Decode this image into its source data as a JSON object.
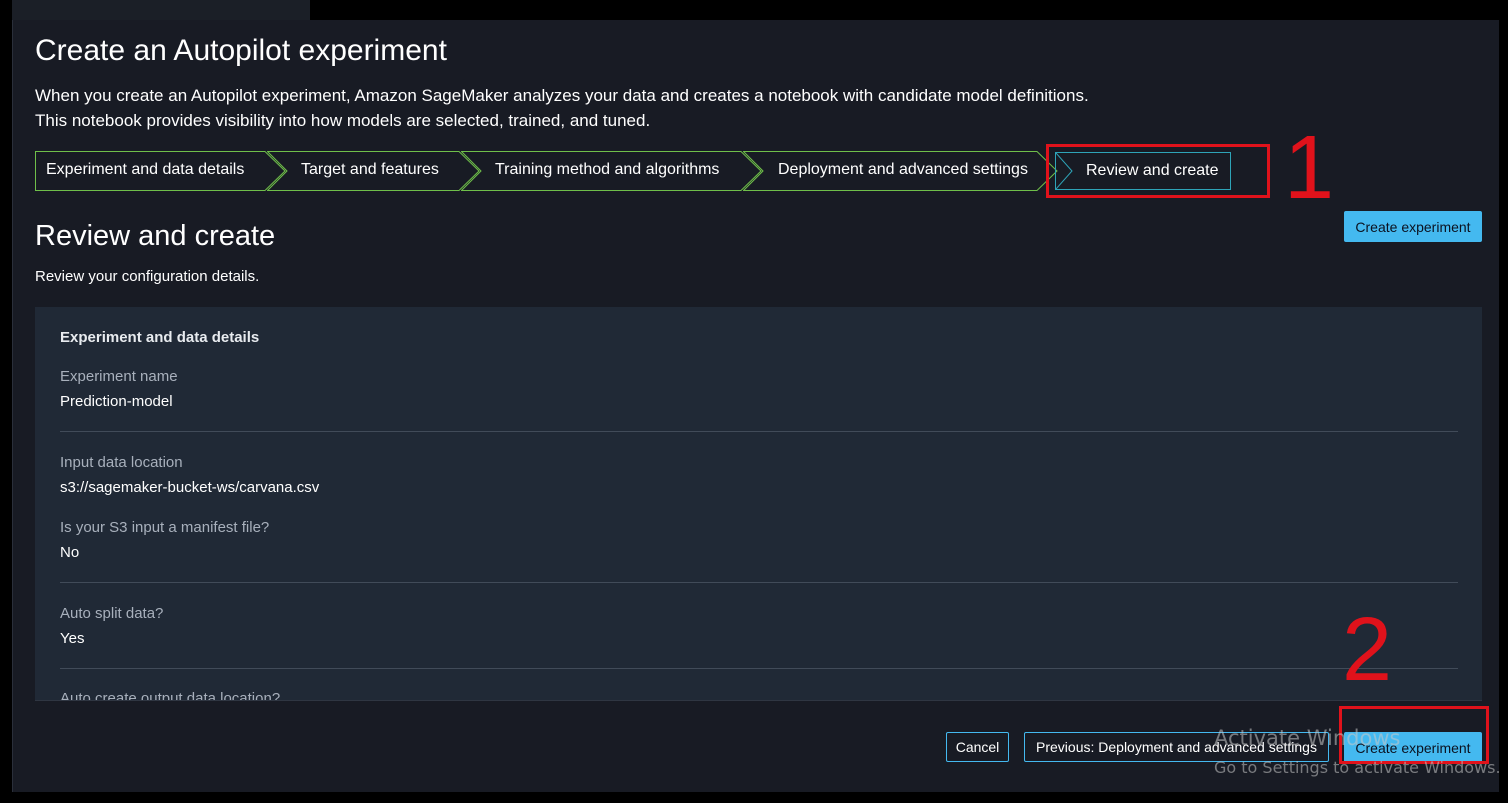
{
  "page": {
    "title": "Create an Autopilot experiment",
    "description_line1": "When you create an Autopilot experiment, Amazon SageMaker analyzes your data and creates a notebook with candidate model definitions.",
    "description_line2": "This notebook provides visibility into how models are selected, trained, and tuned."
  },
  "steps": [
    {
      "label": "Experiment and data details",
      "state": "completed"
    },
    {
      "label": "Target and features",
      "state": "completed"
    },
    {
      "label": "Training method and algorithms",
      "state": "completed"
    },
    {
      "label": "Deployment and advanced settings",
      "state": "completed"
    },
    {
      "label": "Review and create",
      "state": "active"
    }
  ],
  "section": {
    "heading": "Review and create",
    "subheading": "Review your configuration details."
  },
  "panel": {
    "title": "Experiment and data details",
    "fields": [
      {
        "label": "Experiment name",
        "value": "Prediction-model"
      },
      {
        "label": "Input data location",
        "value": "s3://sagemaker-bucket-ws/carvana.csv"
      },
      {
        "label": "Is your S3 input a manifest file?",
        "value": "No"
      },
      {
        "label": "Auto split data?",
        "value": "Yes"
      },
      {
        "label": "Auto create output data location?",
        "value": ""
      }
    ]
  },
  "buttons": {
    "create_top": "Create experiment",
    "cancel": "Cancel",
    "previous": "Previous: Deployment and advanced settings",
    "create_bottom": "Create experiment"
  },
  "annotations": {
    "marker1": "1",
    "marker2": "2",
    "color": "#e0121b"
  },
  "watermark": {
    "line1": "Activate Windows",
    "line2": "Go to Settings to activate Windows."
  },
  "colors": {
    "background": "#181b24",
    "panel": "#202936",
    "primary_button": "#44b9f0",
    "step_completed_border": "#6fbf4a",
    "step_active_border": "#2ea4b8"
  }
}
